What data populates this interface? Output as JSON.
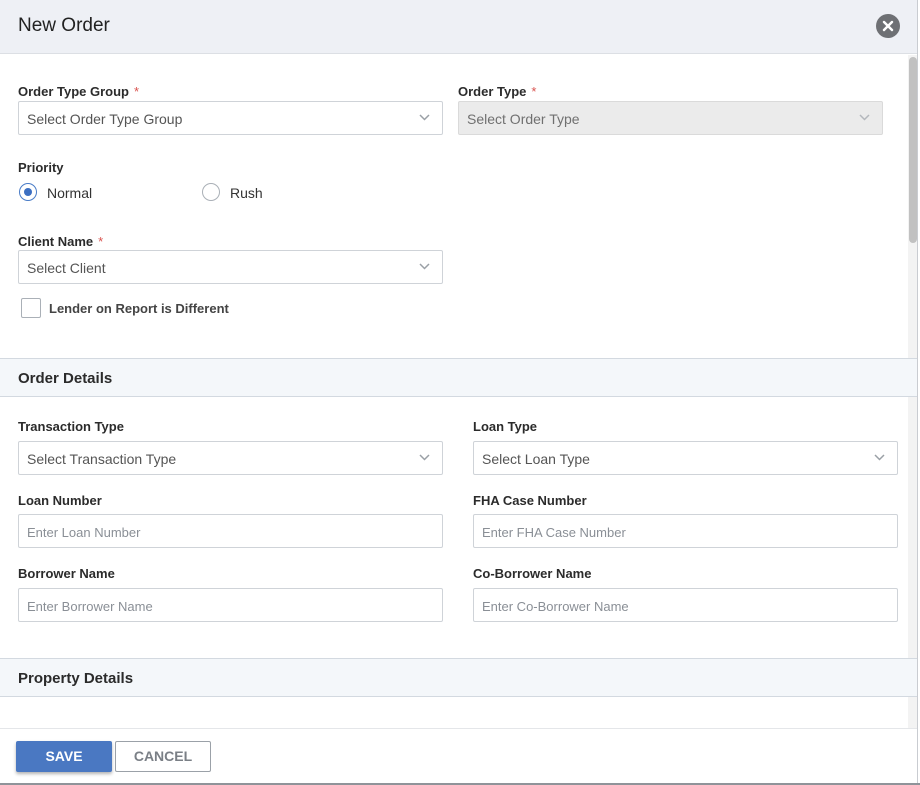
{
  "modal": {
    "title": "New Order"
  },
  "form": {
    "order_type_group": {
      "label": "Order Type Group",
      "required": "*",
      "placeholder": "Select Order Type Group"
    },
    "order_type": {
      "label": "Order Type",
      "required": "*",
      "placeholder": "Select Order Type",
      "disabled": true
    },
    "priority": {
      "label": "Priority",
      "options": [
        {
          "label": "Normal",
          "checked": true
        },
        {
          "label": "Rush",
          "checked": false
        }
      ]
    },
    "client_name": {
      "label": "Client Name",
      "required": "*",
      "placeholder": "Select Client"
    },
    "lender_checkbox": {
      "label": "Lender on Report is Different",
      "checked": false
    }
  },
  "order_details": {
    "title": "Order Details",
    "transaction_type": {
      "label": "Transaction Type",
      "placeholder": "Select Transaction Type"
    },
    "loan_type": {
      "label": "Loan Type",
      "placeholder": "Select Loan Type"
    },
    "loan_number": {
      "label": "Loan Number",
      "placeholder": "Enter Loan Number"
    },
    "fha_case_number": {
      "label": "FHA Case Number",
      "placeholder": "Enter FHA Case Number"
    },
    "borrower_name": {
      "label": "Borrower Name",
      "placeholder": "Enter Borrower Name"
    },
    "co_borrower_name": {
      "label": "Co-Borrower Name",
      "placeholder": "Enter Co-Borrower Name"
    }
  },
  "property_details": {
    "title": "Property Details"
  },
  "footer": {
    "save_label": "SAVE",
    "cancel_label": "CANCEL"
  },
  "colors": {
    "accent": "#4a78c2",
    "required": "#d9534f",
    "header_bg": "#eef0f5",
    "section_bg": "#f4f7fa"
  },
  "icons": {
    "close": "close-icon",
    "dropdown": "chevron-down-icon"
  }
}
